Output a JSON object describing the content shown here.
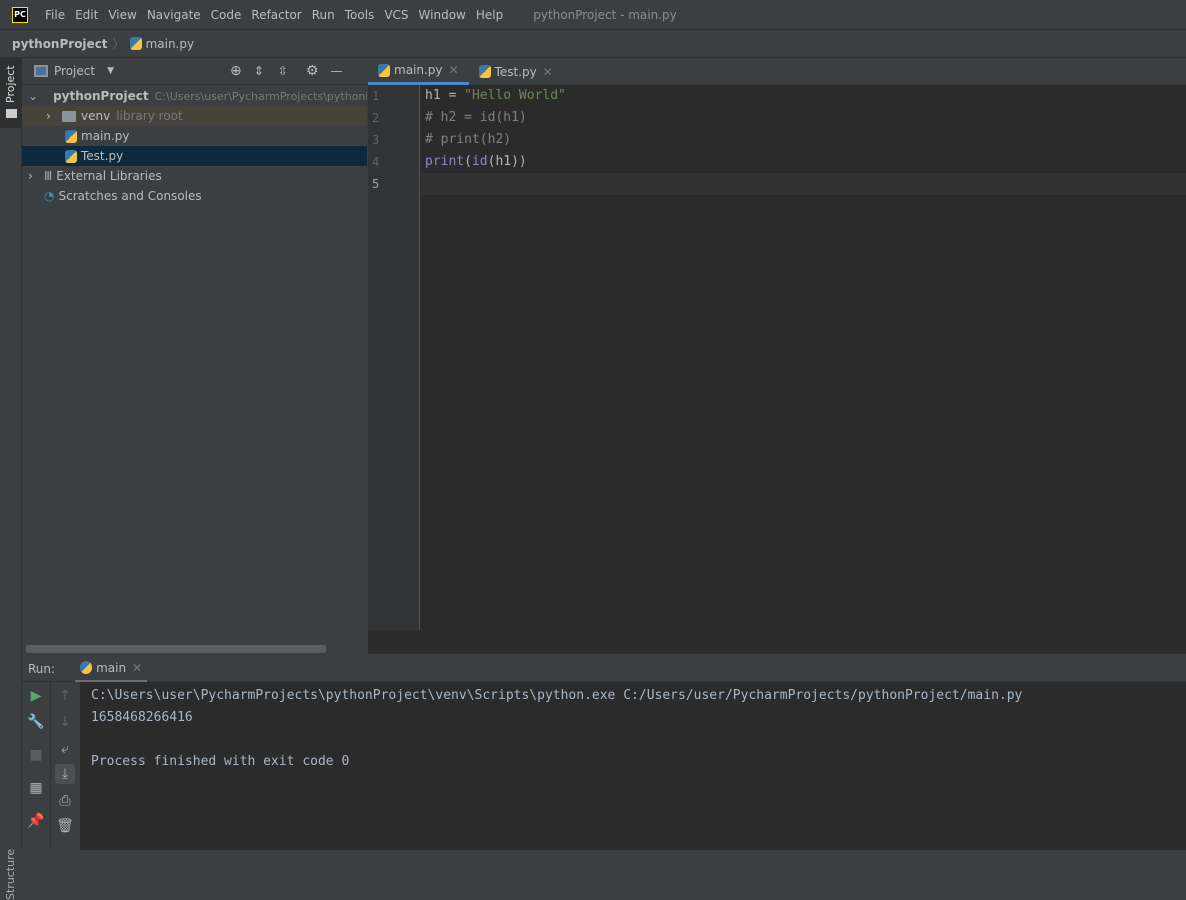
{
  "menubar": {
    "logo": "PC",
    "items": [
      "File",
      "Edit",
      "View",
      "Navigate",
      "Code",
      "Refactor",
      "Run",
      "Tools",
      "VCS",
      "Window",
      "Help"
    ],
    "title": "pythonProject - main.py"
  },
  "breadcrumb": {
    "project": "pythonProject",
    "file": "main.py"
  },
  "stripe": {
    "project_tab": "Project",
    "structure_tab": "Structure"
  },
  "project_panel": {
    "title": "Project",
    "tree": {
      "root": "pythonProject",
      "root_path": "C:\\Users\\user\\PycharmProjects\\pythonProject",
      "venv": "venv",
      "venv_hint": "library root",
      "main": "main.py",
      "test": "Test.py",
      "external": "External Libraries",
      "scratches": "Scratches and Consoles"
    }
  },
  "editor": {
    "tabs": [
      "main.py",
      "Test.py"
    ],
    "line_numbers": [
      "1",
      "2",
      "3",
      "4",
      "5"
    ],
    "lines": [
      {
        "a": "h1 = ",
        "b": "\"Hello World\""
      },
      {
        "a": "# h2 = id(h1)"
      },
      {
        "a": "# print(h2)"
      },
      {
        "a": "print",
        "b": "(",
        "c": "id",
        "d": "(h1))"
      }
    ]
  },
  "run": {
    "label": "Run:",
    "tab": "main",
    "output": [
      "C:\\Users\\user\\PycharmProjects\\pythonProject\\venv\\Scripts\\python.exe C:/Users/user/PycharmProjects/pythonProject/main.py",
      "1658468266416",
      "",
      "Process finished with exit code 0"
    ]
  }
}
